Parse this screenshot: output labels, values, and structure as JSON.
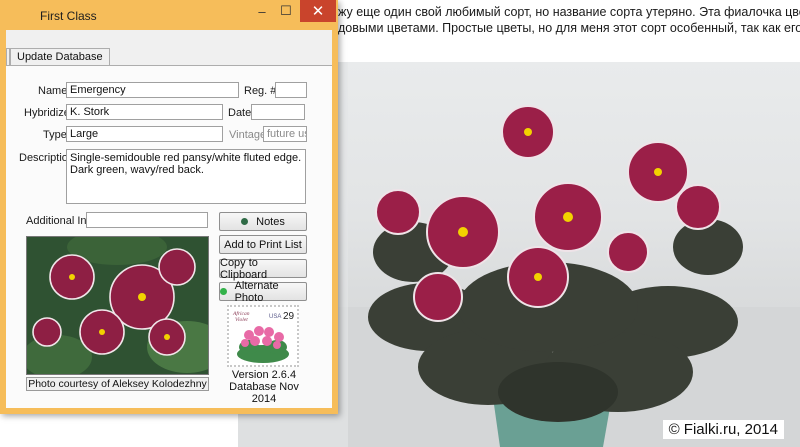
{
  "background": {
    "line1": "жу еще один свой любимый сорт, но название сорта утеряно. Эта фиалочка цветет с",
    "line2": "довыми цветами. Простые цветы, но для меня этот сорт особенный, так как его мне п",
    "copyright": "© Fialki.ru, 2014"
  },
  "window": {
    "title": "First Class",
    "minimize_label": "–",
    "maximize_label": "☐",
    "close_label": "✕",
    "accent": "#f6bd5a"
  },
  "tabs": {
    "update_database": "Update Database"
  },
  "form": {
    "name_label": "Name",
    "name_value": "Emergency",
    "reg_label": "Reg. #",
    "reg_value": "",
    "hybridizer_label": "Hybridizer",
    "hybridizer_value": "K. Stork",
    "date_label": "Date",
    "date_value": "",
    "type_label": "Type",
    "type_value": "Large",
    "vintage_label": "Vintage",
    "vintage_value": "future use",
    "description_label": "Description",
    "description_value": "Single-semidouble red pansy/white fluted edge. Dark green, wavy/red back.",
    "additional_label": "Additional Info",
    "additional_value": ""
  },
  "buttons": {
    "notes": "Notes",
    "add_print": "Add to Print List",
    "copy_clipboard": "Copy to Clipboard",
    "alternate_photo": "Alternate Photo",
    "notes_dot_color": "#2f6b46",
    "alt_dot_color": "#33b24a"
  },
  "photo_caption": "Photo courtesy of Aleksey Kolodezhny",
  "stamp": {
    "usa": "USA",
    "value": "29",
    "title_line1": "African",
    "title_line2": "Violet"
  },
  "version": {
    "line1": "Version 2.6.4",
    "line2": "Database Nov 2014"
  }
}
